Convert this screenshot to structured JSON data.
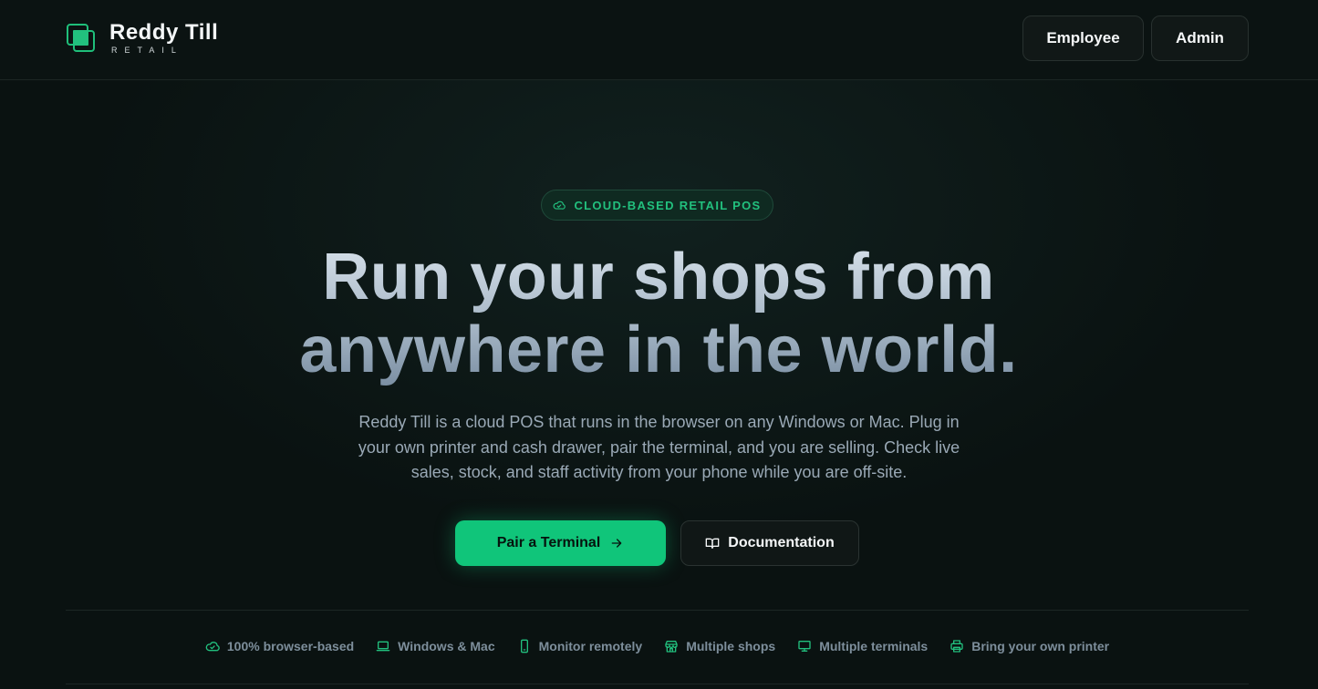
{
  "header": {
    "brand_name": "Reddy Till",
    "brand_sub": "RETAIL",
    "employee_label": "Employee",
    "admin_label": "Admin"
  },
  "hero": {
    "badge_label": "CLOUD-BASED RETAIL POS",
    "title_line1": "Run your shops from",
    "title_line2": "anywhere in the world.",
    "subtitle": "Reddy Till is a cloud POS that runs in the browser on any Windows or Mac. Plug in your own printer and cash drawer, pair the terminal, and you are selling. Check live sales, stock, and staff activity from your phone while you are off-site.",
    "primary_cta": "Pair a Terminal",
    "secondary_cta": "Documentation"
  },
  "features": [
    {
      "icon": "cloud-icon",
      "label": "100% browser-based"
    },
    {
      "icon": "laptop-icon",
      "label": "Windows & Mac"
    },
    {
      "icon": "phone-icon",
      "label": "Monitor remotely"
    },
    {
      "icon": "store-icon",
      "label": "Multiple shops"
    },
    {
      "icon": "monitor-icon",
      "label": "Multiple terminals"
    },
    {
      "icon": "printer-icon",
      "label": "Bring your own printer"
    }
  ],
  "colors": {
    "background": "#0a1211",
    "accent": "#10c57a",
    "muted_text": "#7d8e9b"
  }
}
